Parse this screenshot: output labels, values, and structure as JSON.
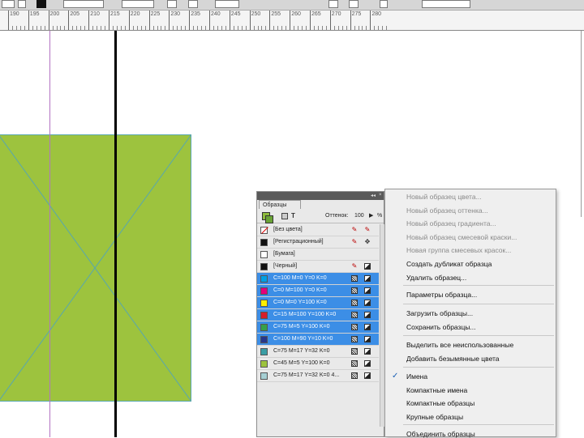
{
  "colors": {
    "rect_fill": "#9dc33e",
    "rect_stroke": "#59a7ad",
    "guide": "#b273c2",
    "selection": "#3c8ee6",
    "panel_bg": "#e9e9e9",
    "menu_bg": "#efefef"
  },
  "ruler": {
    "ticks": [
      "190",
      "195",
      "200",
      "205",
      "210",
      "215",
      "220",
      "225",
      "230",
      "235",
      "240",
      "245",
      "250",
      "255",
      "260",
      "265",
      "270",
      "275",
      "280"
    ]
  },
  "swatches_panel": {
    "title": "Образцы",
    "tint_label": "Оттенок:",
    "tint_value": "100",
    "tint_arrow": "▶",
    "tint_unit": "%",
    "rows": [
      {
        "name": "[Без цвета]",
        "color": "none",
        "selected": false
      },
      {
        "name": "[Регистрационный]",
        "color": "#111111",
        "selected": false
      },
      {
        "name": "[Бумага]",
        "color": "#ffffff",
        "selected": false
      },
      {
        "name": "[Черный]",
        "color": "#111111",
        "selected": false
      },
      {
        "name": "C=100 M=0 Y=0 K=0",
        "color": "#00a0e3",
        "selected": true
      },
      {
        "name": "C=0 M=100 Y=0 K=0",
        "color": "#e4007c",
        "selected": true
      },
      {
        "name": "C=0 M=0 Y=100 K=0",
        "color": "#fff000",
        "selected": true
      },
      {
        "name": "C=15 M=100 Y=100 K=0",
        "color": "#d51e2b",
        "selected": true
      },
      {
        "name": "C=75 M=5 Y=100 K=0",
        "color": "#36a04a",
        "selected": true
      },
      {
        "name": "C=100 M=90 Y=10 K=0",
        "color": "#26378b",
        "selected": true
      },
      {
        "name": "C=75 M=17 Y=32 K=0",
        "color": "#3b9ea5",
        "selected": false
      },
      {
        "name": "C=45 M=5 Y=100 K=0",
        "color": "#9dc33e",
        "selected": false
      },
      {
        "name": "C=75 M=17 Y=32 K=0 4...",
        "color": "#a6cfd3",
        "selected": false
      }
    ]
  },
  "context_menu": {
    "items": [
      {
        "label": "Новый образец цвета...",
        "disabled": true,
        "checked": false
      },
      {
        "label": "Новый образец оттенка...",
        "disabled": true,
        "checked": false
      },
      {
        "label": "Новый образец градиента...",
        "disabled": true,
        "checked": false
      },
      {
        "label": "Новый образец смесевой краски...",
        "disabled": true,
        "checked": false
      },
      {
        "label": "Новая группа смесевых красок...",
        "disabled": true,
        "checked": false
      },
      {
        "label": "Создать дубликат образца",
        "disabled": false,
        "checked": false
      },
      {
        "label": "Удалить образец...",
        "disabled": false,
        "checked": false
      },
      {
        "label": "Параметры образца...",
        "disabled": false,
        "checked": false
      },
      {
        "label": "Загрузить образцы...",
        "disabled": false,
        "checked": false
      },
      {
        "label": "Сохранить образцы...",
        "disabled": false,
        "checked": false
      },
      {
        "label": "Выделить все неиспользованные",
        "disabled": false,
        "checked": false
      },
      {
        "label": "Добавить безымянные цвета",
        "disabled": false,
        "checked": false
      },
      {
        "label": "Имена",
        "disabled": false,
        "checked": true
      },
      {
        "label": "Компактные имена",
        "disabled": false,
        "checked": false
      },
      {
        "label": "Компактные образцы",
        "disabled": false,
        "checked": false
      },
      {
        "label": "Крупные образцы",
        "disabled": false,
        "checked": false
      },
      {
        "label": "Объединить образцы",
        "disabled": false,
        "checked": false
      }
    ]
  }
}
